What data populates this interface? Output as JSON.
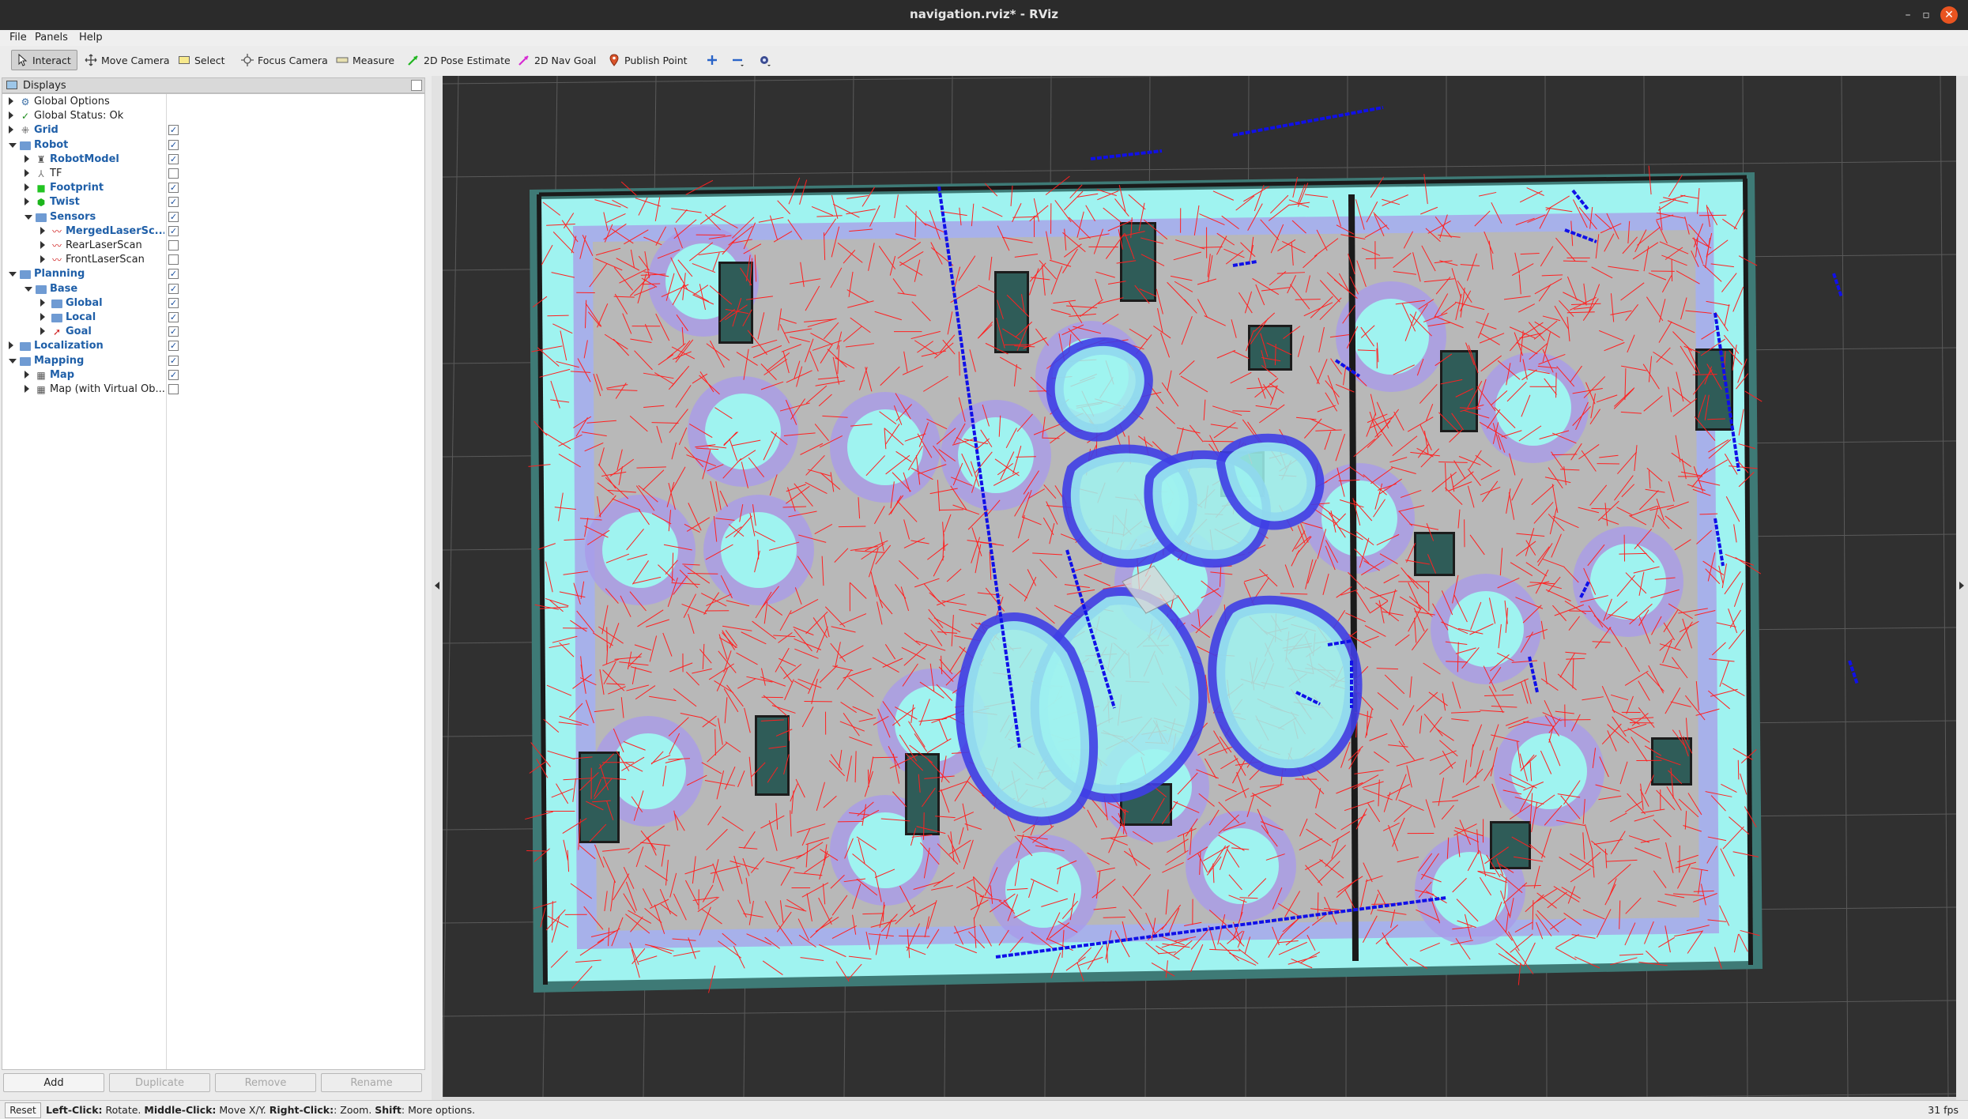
{
  "window": {
    "title": "navigation.rviz* - RViz",
    "controls": {
      "minimize": "–",
      "maximize": "▫",
      "close": "✕"
    }
  },
  "menubar": [
    {
      "label": "File",
      "mnemonic": "F"
    },
    {
      "label": "Panels",
      "mnemonic": "P"
    },
    {
      "label": "Help",
      "mnemonic": "H"
    }
  ],
  "toolbar": {
    "tools": [
      {
        "label": "Interact",
        "icon": "cursor-icon",
        "active": true
      },
      {
        "label": "Move Camera",
        "icon": "move-icon",
        "active": false
      },
      {
        "label": "Select",
        "icon": "select-box-icon",
        "active": false
      },
      {
        "label": "Focus Camera",
        "icon": "focus-icon",
        "active": false
      },
      {
        "label": "Measure",
        "icon": "ruler-icon",
        "active": false
      },
      {
        "label": "2D Pose Estimate",
        "icon": "green-arrow-icon",
        "active": false
      },
      {
        "label": "2D Nav Goal",
        "icon": "pink-arrow-icon",
        "active": false
      },
      {
        "label": "Publish Point",
        "icon": "pin-icon",
        "active": false
      }
    ]
  },
  "displays": {
    "header": "Displays",
    "items": [
      {
        "label": "Global Options",
        "depth": 0,
        "expander": "collapsed",
        "icon": "gear-icon",
        "bold": false,
        "checkbox": null
      },
      {
        "label": "Global Status: Ok",
        "depth": 0,
        "expander": "collapsed",
        "icon": "check-icon",
        "bold": false,
        "checkbox": null
      },
      {
        "label": "Grid",
        "depth": 0,
        "expander": "collapsed",
        "icon": "grid-icon",
        "bold": true,
        "checkbox": true
      },
      {
        "label": "Robot",
        "depth": 0,
        "expander": "expanded",
        "icon": "folder-icon",
        "bold": true,
        "checkbox": true
      },
      {
        "label": "RobotModel",
        "depth": 1,
        "expander": "collapsed",
        "icon": "robot-icon",
        "bold": true,
        "checkbox": true
      },
      {
        "label": "TF",
        "depth": 1,
        "expander": "collapsed",
        "icon": "tf-icon",
        "bold": false,
        "checkbox": false
      },
      {
        "label": "Footprint",
        "depth": 1,
        "expander": "collapsed",
        "icon": "polygon-icon",
        "bold": true,
        "checkbox": true
      },
      {
        "label": "Twist",
        "depth": 1,
        "expander": "collapsed",
        "icon": "cube-icon",
        "bold": true,
        "checkbox": true
      },
      {
        "label": "Sensors",
        "depth": 1,
        "expander": "expanded",
        "icon": "folder-icon",
        "bold": true,
        "checkbox": true
      },
      {
        "label": "MergedLaserSc...",
        "depth": 2,
        "expander": "collapsed",
        "icon": "laser-icon",
        "bold": true,
        "checkbox": true
      },
      {
        "label": "RearLaserScan",
        "depth": 2,
        "expander": "collapsed",
        "icon": "laser-icon",
        "bold": false,
        "checkbox": false
      },
      {
        "label": "FrontLaserScan",
        "depth": 2,
        "expander": "collapsed",
        "icon": "laser-icon",
        "bold": false,
        "checkbox": false
      },
      {
        "label": "Planning",
        "depth": 0,
        "expander": "expanded",
        "icon": "folder-icon",
        "bold": true,
        "checkbox": true
      },
      {
        "label": "Base",
        "depth": 1,
        "expander": "expanded",
        "icon": "folder-icon",
        "bold": true,
        "checkbox": true
      },
      {
        "label": "Global",
        "depth": 2,
        "expander": "collapsed",
        "icon": "folder-icon",
        "bold": true,
        "checkbox": true
      },
      {
        "label": "Local",
        "depth": 2,
        "expander": "collapsed",
        "icon": "folder-icon",
        "bold": true,
        "checkbox": true
      },
      {
        "label": "Goal",
        "depth": 2,
        "expander": "collapsed",
        "icon": "pose-arrow-icon",
        "bold": true,
        "checkbox": true
      },
      {
        "label": "Localization",
        "depth": 0,
        "expander": "collapsed",
        "icon": "folder-icon",
        "bold": true,
        "checkbox": true
      },
      {
        "label": "Mapping",
        "depth": 0,
        "expander": "expanded",
        "icon": "folder-icon",
        "bold": true,
        "checkbox": true
      },
      {
        "label": "Map",
        "depth": 1,
        "expander": "collapsed",
        "icon": "map-icon",
        "bold": true,
        "checkbox": true
      },
      {
        "label": "Map (with Virtual Ob...",
        "depth": 1,
        "expander": "collapsed",
        "icon": "map-icon",
        "bold": false,
        "checkbox": false
      }
    ],
    "buttons": [
      {
        "label": "Add",
        "enabled": true
      },
      {
        "label": "Duplicate",
        "enabled": false
      },
      {
        "label": "Remove",
        "enabled": false
      },
      {
        "label": "Rename",
        "enabled": false
      }
    ]
  },
  "colors": {
    "viewport_bg": "#303030",
    "grid_line": "#5a5a5a",
    "free_space": "#b8b8b8",
    "inflation_cyan": "#9ff3f0",
    "inflation_purple": "#a99be8",
    "laser_blue": "#1010e8",
    "particle_red": "#ff2020",
    "obstacle": "#2f5c58"
  },
  "statusbar": {
    "reset_label": "Reset",
    "hint_parts": [
      {
        "text": "Left-Click:",
        "bold": true
      },
      {
        "text": " Rotate. ",
        "bold": false
      },
      {
        "text": "Middle-Click:",
        "bold": true
      },
      {
        "text": " Move X/Y. ",
        "bold": false
      },
      {
        "text": "Right-Click:",
        "bold": true
      },
      {
        "text": ": Zoom. ",
        "bold": false
      },
      {
        "text": "Shift",
        "bold": true
      },
      {
        "text": ": More options.",
        "bold": false
      }
    ],
    "fps": "31 fps"
  }
}
